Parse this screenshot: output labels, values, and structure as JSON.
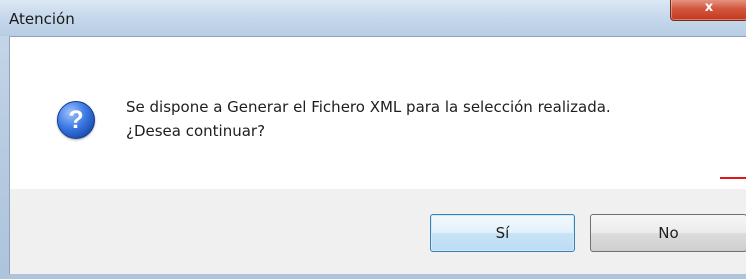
{
  "dialog": {
    "title": "Atención",
    "close_label": "x",
    "message_line1": "Se dispone a Generar el Fichero XML para la selección realizada.",
    "message_line2": "¿Desea continuar?",
    "icon": "question-icon",
    "icon_glyph": "?",
    "buttons": {
      "yes_label": "Sí",
      "no_label": "No"
    }
  },
  "colors": {
    "title_bar": "#c7d9ec",
    "close_button": "#d2553b",
    "content_background": "#ffffff",
    "button_area": "#f0f0f0",
    "default_button_border": "#3c7fb1",
    "question_icon": "#2a62c8",
    "red_mark": "#e0161a"
  }
}
